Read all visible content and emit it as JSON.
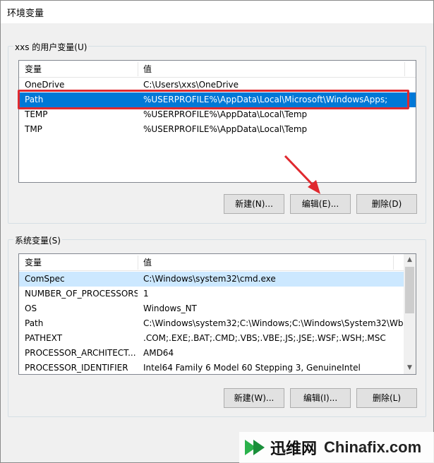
{
  "window": {
    "title": "环境变量"
  },
  "user_vars": {
    "group_label": "xxs 的用户变量(U)",
    "columns": [
      "变量",
      "值"
    ],
    "rows": [
      {
        "name": "OneDrive",
        "value": "C:\\Users\\xxs\\OneDrive"
      },
      {
        "name": "Path",
        "value": "%USERPROFILE%\\AppData\\Local\\Microsoft\\WindowsApps;"
      },
      {
        "name": "TEMP",
        "value": "%USERPROFILE%\\AppData\\Local\\Temp"
      },
      {
        "name": "TMP",
        "value": "%USERPROFILE%\\AppData\\Local\\Temp"
      }
    ],
    "selected_row": "Path",
    "buttons": {
      "new": "新建(N)...",
      "edit": "编辑(E)...",
      "delete": "删除(D)"
    }
  },
  "system_vars": {
    "group_label": "系统变量(S)",
    "columns": [
      "变量",
      "值"
    ],
    "rows": [
      {
        "name": "ComSpec",
        "value": "C:\\Windows\\system32\\cmd.exe"
      },
      {
        "name": "NUMBER_OF_PROCESSORS",
        "value": "1"
      },
      {
        "name": "OS",
        "value": "Windows_NT"
      },
      {
        "name": "Path",
        "value": "C:\\Windows\\system32;C:\\Windows;C:\\Windows\\System32\\Wb..."
      },
      {
        "name": "PATHEXT",
        "value": ".COM;.EXE;.BAT;.CMD;.VBS;.VBE;.JS;.JSE;.WSF;.WSH;.MSC"
      },
      {
        "name": "PROCESSOR_ARCHITECT...",
        "value": "AMD64"
      },
      {
        "name": "PROCESSOR_IDENTIFIER",
        "value": "Intel64 Family 6 Model 60 Stepping 3, GenuineIntel"
      }
    ],
    "buttons": {
      "new": "新建(W)...",
      "edit": "编辑(I)...",
      "delete": "删除(L)"
    }
  },
  "watermark": {
    "cn": "迅维网",
    "en": "Chinafix.com"
  },
  "colors": {
    "selection": "#0078d7",
    "highlight_box": "#e0292f",
    "arrow": "#e0292f"
  }
}
